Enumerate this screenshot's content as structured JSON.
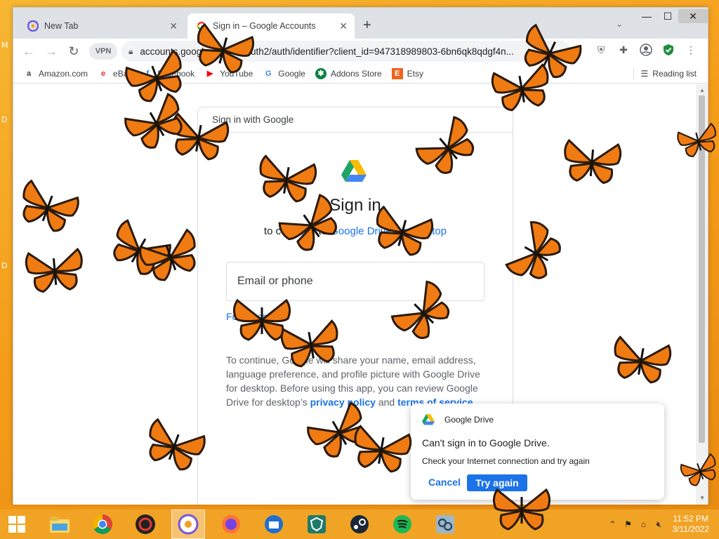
{
  "desktop": {
    "labels": [
      "M",
      "D",
      "D"
    ]
  },
  "tabs": [
    {
      "title": "New Tab",
      "close": "✕"
    },
    {
      "title": "Sign in – Google Accounts",
      "close": "✕"
    }
  ],
  "new_tab_symbol": "+",
  "window_controls": {
    "minimize": "—",
    "maximize": "☐",
    "close": "✕"
  },
  "toolbar": {
    "back": "←",
    "forward": "→",
    "reload": "↻",
    "vpn": "VPN",
    "url": "accounts.google.com/o/oauth2/auth/identifier?client_id=947318989803-6bn6qk8qdgf4n..."
  },
  "bookmarks": [
    {
      "label": "Amazon.com",
      "icon": "amazon-icon",
      "glyph": "a"
    },
    {
      "label": "eBay",
      "icon": "ebay-icon",
      "glyph": "e"
    },
    {
      "label": "Facebook",
      "icon": "facebook-icon",
      "glyph": "f"
    },
    {
      "label": "YouTube",
      "icon": "youtube-icon",
      "glyph": "▶"
    },
    {
      "label": "Google",
      "icon": "google-icon",
      "glyph": "G"
    },
    {
      "label": "Addons Store",
      "icon": "addons-icon",
      "glyph": "✱"
    },
    {
      "label": "Etsy",
      "icon": "etsy-icon",
      "glyph": "E"
    }
  ],
  "reading_list": "Reading list",
  "signin": {
    "header": "Sign in with Google",
    "title": "Sign in",
    "subtitle_prefix": "to continue to ",
    "subtitle_link": "Google Drive for desktop",
    "email_placeholder": "Email or phone",
    "forgot": "Forgot email?",
    "consent_text": "To continue, Google will share your name, email address, language preference, and profile picture with Google Drive for desktop. Before using this app, you can review Google Drive for desktop’s ",
    "privacy": "privacy policy",
    "and": " and ",
    "terms": "terms of service",
    "period": "."
  },
  "notification": {
    "app": "Google Drive",
    "title": "Can't sign in to Google Drive.",
    "body": "Check your Internet connection and try again",
    "cancel": "Cancel",
    "retry": "Try again"
  },
  "taskbar": {
    "apps": [
      "file-explorer",
      "chrome",
      "security-app",
      "vpn-app",
      "firefox",
      "thunderbird",
      "protonvpn",
      "steam",
      "spotify",
      "network-app"
    ],
    "time": "11:52 PM",
    "date": "3/11/2022"
  },
  "colors": {
    "accent": "#1a73e8",
    "taskbar": "#f1a325",
    "butterfly": "#f07b12"
  }
}
